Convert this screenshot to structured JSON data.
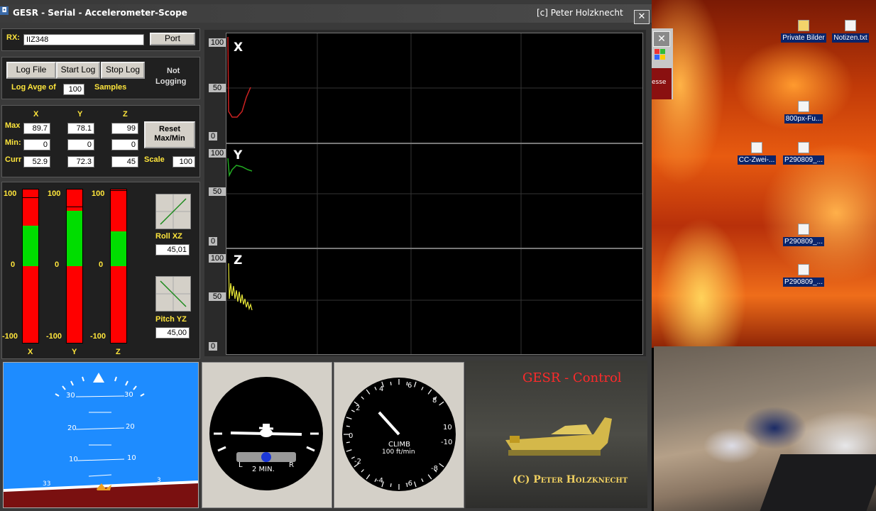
{
  "window": {
    "title": "GESR - Serial - Accelerometer-Scope",
    "copyright": "[c] Peter Holzknecht",
    "close": "✕"
  },
  "rx": {
    "label": "RX:",
    "value": "IIZ348",
    "port_button": "Port"
  },
  "log": {
    "log_file": "Log File",
    "start_log": "Start Log",
    "stop_log": "Stop Log",
    "status_line1": "Not",
    "status_line2": "Logging",
    "avg_label": "Log Avge of",
    "avg_value": "100",
    "samples_label": "Samples"
  },
  "values": {
    "col_x": "X",
    "col_y": "Y",
    "col_z": "Z",
    "max_label": "Max",
    "min_label": "Min:",
    "curr_label": "Curr",
    "max": [
      "89.7",
      "78.1",
      "99"
    ],
    "min": [
      "0",
      "0",
      "0"
    ],
    "curr": [
      "52.9",
      "72.3",
      "45"
    ],
    "reset_line1": "Reset",
    "reset_line2": "Max/Min",
    "scale_label": "Scale",
    "scale_value": "100"
  },
  "bars": {
    "top": "100",
    "mid": "0",
    "bottom": "-100",
    "labels": [
      "X",
      "Y",
      "Z"
    ],
    "levels": [
      52.9,
      72.3,
      45
    ],
    "max_markers": [
      89.7,
      78.1,
      99
    ]
  },
  "attitude": {
    "roll_label": "Roll  XZ",
    "roll_value": "45,01",
    "pitch_label": "Pitch YZ",
    "pitch_value": "45,00"
  },
  "scopes": [
    {
      "name": "X",
      "top": "100",
      "mid": "50",
      "bottom": "0",
      "color": "#cc2222"
    },
    {
      "name": "Y",
      "top": "100",
      "mid": "50",
      "bottom": "0",
      "color": "#22aa22"
    },
    {
      "name": "Z",
      "top": "100",
      "mid": "50",
      "bottom": "0",
      "color": "#e8e838"
    }
  ],
  "horizon": {
    "pitch_marks": [
      "30",
      "20",
      "10"
    ],
    "bank_left": "33",
    "bank_right": "3",
    "sky": "#1e8cff",
    "ground": "#7a1010"
  },
  "turn": {
    "left": "L",
    "right": "R",
    "label": "2 MIN."
  },
  "vsi": {
    "title": "CLIMB",
    "unit": "100 ft/min",
    "ticks": [
      "0",
      "2",
      "4",
      "6",
      "8",
      "10",
      "-10",
      "-8",
      "-6",
      "-4",
      "-2"
    ]
  },
  "video": {
    "title": "GESR - Control",
    "credit": "(C) Peter Holzknecht"
  },
  "desktop": {
    "icons": [
      "Private Bilder",
      "Notizen.txt",
      "800px-Fu...",
      "CC-Zwei-...",
      "P290809_...",
      "P290809_...",
      "P290809_..."
    ],
    "bg_strip": "esse",
    "bg_close": "✕"
  }
}
